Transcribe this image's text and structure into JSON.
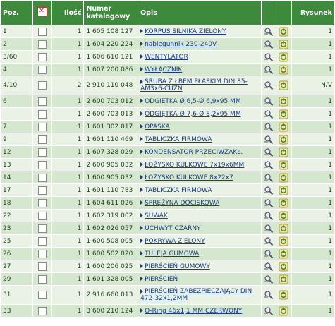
{
  "headers": {
    "pos": "Poz.",
    "qty": "Ilość",
    "catalog": "Numer katalogowy",
    "desc": "Opis",
    "fig": "Rysunek"
  },
  "rows": [
    {
      "pos": "1",
      "qty": "1",
      "num": "1 605 108 127",
      "desc": "KORPUS SILNIKA ZIELONY",
      "fig": "1"
    },
    {
      "pos": "2",
      "qty": "1",
      "num": "1 604 220 224",
      "desc": "nabiegunnik 230-240V",
      "fig": "1"
    },
    {
      "pos": "3/60",
      "qty": "1",
      "num": "1 606 610 121",
      "desc": "WENTYLATOR",
      "fig": "1"
    },
    {
      "pos": "4",
      "qty": "1",
      "num": "1 607 200 086",
      "desc": "WYŁĄCZNIK",
      "fig": "1"
    },
    {
      "pos": "4/10",
      "qty": "2",
      "num": "2 910 110 048",
      "desc": "ŚRUBA Z ŁBEM PŁASKIM DIN 85-AM3x6-CUZN",
      "fig": "N/V"
    },
    {
      "pos": "6",
      "qty": "1",
      "num": "2 600 703 012",
      "desc": "ODGIĘTKA Ø 6,5-Ø 6,9x95 MM",
      "fig": "1"
    },
    {
      "pos": "",
      "qty": "1",
      "num": "2 600 703 013",
      "desc": "ODGIĘTKA Ø 7,6-Ø 8,2x95 MM",
      "fig": "1"
    },
    {
      "pos": "7",
      "qty": "1",
      "num": "1 601 302 017",
      "desc": "OPASKA",
      "fig": "1"
    },
    {
      "pos": "9",
      "qty": "1",
      "num": "1 601 110 469",
      "desc": "TABLICZKA FIRMOWA",
      "fig": "1"
    },
    {
      "pos": "12",
      "qty": "1",
      "num": "1 607 328 029",
      "desc": "KONDENSATOR PRZECIWZAKŁ.",
      "fig": "1"
    },
    {
      "pos": "13",
      "qty": "1",
      "num": "2 600 905 032",
      "desc": "ŁOŻYSKO KULKOWE 7x19x6MM",
      "fig": "1"
    },
    {
      "pos": "14",
      "qty": "1",
      "num": "1 600 905 032",
      "desc": "ŁOŻYSKO KULKOWE 8x22x7",
      "fig": "1"
    },
    {
      "pos": "17",
      "qty": "1",
      "num": "1 601 110 783",
      "desc": "TABLICZKA FIRMOWA",
      "fig": "1"
    },
    {
      "pos": "18",
      "qty": "1",
      "num": "1 604 611 026",
      "desc": "SPRĘŻYNA DOCISKOWA",
      "fig": "1"
    },
    {
      "pos": "22",
      "qty": "1",
      "num": "1 602 319 002",
      "desc": "SUWAK",
      "fig": "1"
    },
    {
      "pos": "23",
      "qty": "1",
      "num": "1 602 026 057",
      "desc": "UCHWYT CZARNY",
      "fig": "1"
    },
    {
      "pos": "25",
      "qty": "1",
      "num": "1 600 508 005",
      "desc": "POKRYWA ZIELONY",
      "fig": "1"
    },
    {
      "pos": "26",
      "qty": "1",
      "num": "1 600 502 020",
      "desc": "TULEJA GUMOWA",
      "fig": "1"
    },
    {
      "pos": "27",
      "qty": "1",
      "num": "1 600 206 025",
      "desc": "PIERŚCIEŃ GUMOWY",
      "fig": "1"
    },
    {
      "pos": "29",
      "qty": "1",
      "num": "1 601 328 005",
      "desc": "PIERŚCIEŃ",
      "fig": "1"
    },
    {
      "pos": "31",
      "qty": "1",
      "num": "2 916 660 013",
      "desc": "PIERŚCIEŃ ZABEZPIECZAJĄCY DIN 472-32x1,2MM",
      "fig": "1"
    },
    {
      "pos": "33",
      "qty": "1",
      "num": "3 600 210 124",
      "desc": "O-Ring 46x1,1 MM CZERWONY",
      "fig": "1"
    }
  ],
  "colors": {
    "header_bg": "#3d8a3d",
    "row_light": "#e9f2e4",
    "row_dark": "#d6e7cf",
    "link": "#1a3c8a"
  },
  "icons": {
    "select_all": "clear-selection-icon",
    "details": "magnifier-tool-icon",
    "cart": "basket-icon"
  }
}
